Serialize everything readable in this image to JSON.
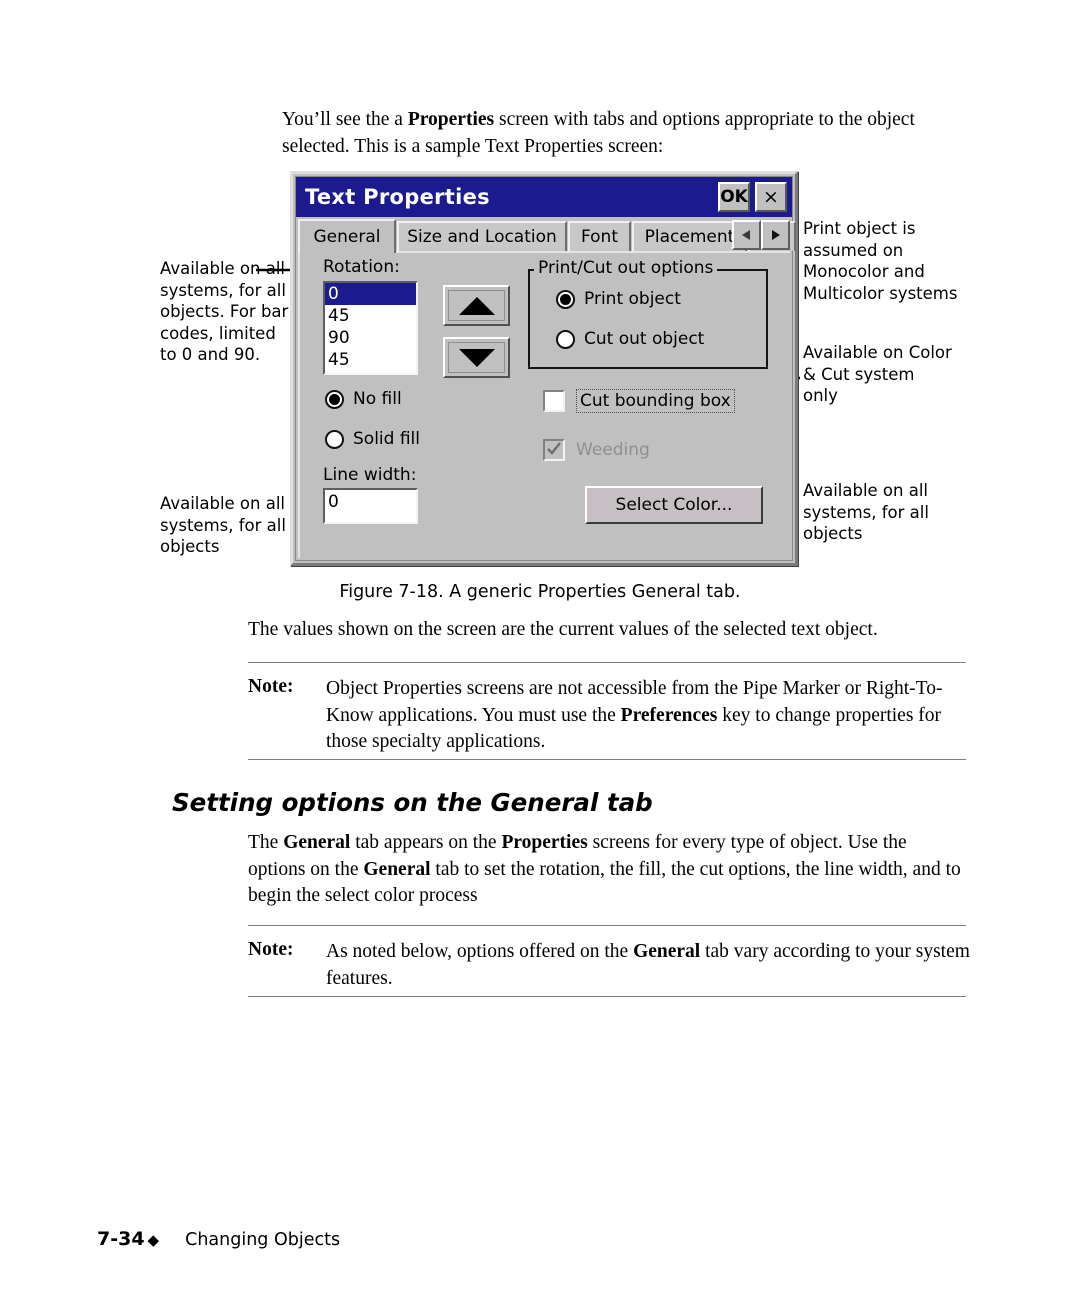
{
  "intro": {
    "line1_a": "You’ll see the a ",
    "line1_b": "Properties",
    "line1_c": " screen with tabs and options appropriate to the",
    "line2": "object selected. This is a sample Text Properties screen:"
  },
  "dialog": {
    "title": "Text Properties",
    "ok_label": "OK",
    "close_label": "×",
    "tabs": [
      {
        "label": "General",
        "active": true
      },
      {
        "label": "Size and Location",
        "active": false
      },
      {
        "label": "Font",
        "active": false
      },
      {
        "label": "Placement",
        "active": false
      },
      {
        "label": "C",
        "active": false
      }
    ],
    "scroll_left": "left-triangle-icon",
    "scroll_right": "right-triangle-icon",
    "rotation": {
      "label": "Rotation:",
      "options": [
        "0",
        "45",
        "90",
        "45"
      ],
      "selected_index": 0,
      "spin_up_icon": "up-triangle-icon",
      "spin_down_icon": "down-triangle-icon"
    },
    "fill": {
      "no_fill_label": "No fill",
      "solid_fill_label": "Solid fill",
      "selected": "No fill"
    },
    "line_width": {
      "label": "Line width:",
      "value": "0"
    },
    "print_cut_group": {
      "legend": "Print/Cut out options",
      "print_object_label": "Print object",
      "cut_object_label": "Cut out object",
      "selected": "Print object"
    },
    "checkboxes": {
      "cut_bounding_box_label": "Cut bounding box",
      "cut_bounding_box_checked": false,
      "weeding_label": "Weeding",
      "weeding_checked": true,
      "weeding_disabled": true
    },
    "select_color_label": "Select Color...",
    "colors": {
      "titlebar": "#1b1b8f",
      "face": "#c0c0c0",
      "highlight": "#1b1b8f",
      "field": "#ffffff",
      "disabled_text": "#8f8f8f"
    }
  },
  "annotations": {
    "rotation": "Available on all systems, for all objects. For bar codes, limited to 0 and 90.",
    "line_width": "Available on all systems, for all objects",
    "print_object": "Print object is assumed on Monocolor and Multicolor systems",
    "color_cut": "Available on Color & Cut system only",
    "select_color": "Available on all systems, for all objects"
  },
  "caption": "Figure 7-18. A generic Properties General tab.",
  "values_paragraph": "The values shown on the screen are the current values of the selected text object.",
  "note_one": {
    "label": "Note:",
    "line1": "Object Properties screens are not accessible from the Pipe Marker or",
    "line2_a": "Right-To-Know applications. You must use the ",
    "line2_b": "Preferences",
    "line2_c": " key to change",
    "line3": "properties for those specialty applications."
  },
  "section_heading": "Setting options on the General tab",
  "general_paragraph": {
    "line1_a": "The ",
    "line1_b": "General",
    "line1_c": " tab appears on the ",
    "line1_d": "Properties",
    "line1_e": " screens for every type of object. Use",
    "line2_a": "the options on the ",
    "line2_b": "General",
    "line2_c": " tab to set the rotation, the fill, the cut options, the line",
    "line3": "width, and to begin the select color process"
  },
  "note_two": {
    "label": "Note:",
    "line1_a": "As noted below, options offered on the ",
    "line1_b": "General",
    "line1_c": " tab vary according to your",
    "line2": "system features."
  },
  "footer": {
    "page_number": "7-34",
    "diamond": "◆",
    "chapter": "Changing Objects"
  }
}
